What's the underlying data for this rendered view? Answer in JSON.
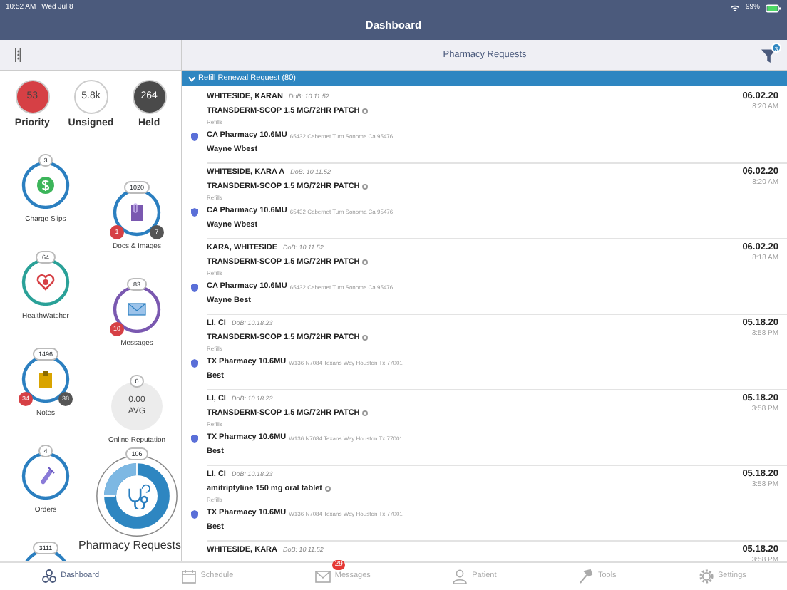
{
  "status_bar": {
    "time": "10:52 AM",
    "date": "Wed Jul 8",
    "battery": "99%"
  },
  "header": {
    "title": "Dashboard"
  },
  "counters": [
    {
      "value": "53",
      "label": "Priority",
      "color": "#d64045"
    },
    {
      "value": "5.8k",
      "label": "Unsigned",
      "color": "#ffffff"
    },
    {
      "value": "264",
      "label": "Held",
      "color": "#4a4a4a"
    }
  ],
  "widgets": {
    "column_1": [
      {
        "kind": "ring",
        "count": "3",
        "label": "Charge Slips",
        "color": "#2b7fc0"
      },
      {
        "kind": "ring",
        "count": "64",
        "label": "HealthWatcher",
        "color": "#2aa198"
      },
      {
        "kind": "ring",
        "count": "1496",
        "label": "Notes",
        "color": "#2b7fc0",
        "badges": [
          {
            "text": "34",
            "color": "#d64045"
          },
          {
            "text": "38",
            "color": "#555555"
          }
        ]
      },
      {
        "kind": "ring",
        "count": "4",
        "label": "Orders",
        "color": "#2b7fc0"
      },
      {
        "kind": "ring",
        "count": "3111",
        "color": "#2b7fc0"
      }
    ],
    "column_2": [
      {
        "kind": "ring",
        "count": "1020",
        "label": "Docs & Images",
        "color": "#2b7fc0",
        "badges": [
          {
            "text": "1",
            "color": "#d64045"
          },
          {
            "text": "7",
            "color": "#555555"
          }
        ]
      },
      {
        "kind": "ring",
        "count": "83",
        "label": "Messages",
        "color": "#7a58b0",
        "badges": [
          {
            "text": "10",
            "color": "#d64045"
          }
        ]
      },
      {
        "kind": "rating",
        "count": "0",
        "value": "0.00",
        "unit": "AVG",
        "label": "Online Reputation"
      },
      {
        "kind": "donut",
        "count": "106",
        "label": "Pharmacy Requests",
        "color": "#2e86c1"
      }
    ]
  },
  "panel": {
    "title": "Pharmacy Requests",
    "filter_badge": "3",
    "group": {
      "label": "Refill Renewal Request (80)",
      "expanded": true
    },
    "requests": [
      {
        "name": "WHITESIDE, KARAN",
        "dob": "DoB: 10.11.52",
        "drug": "TRANSDERM-SCOP 1.5 MG/72HR PATCH",
        "note": "Refills",
        "pharmacy": "CA Pharmacy 10.6MU",
        "address": "65432 Cabernet Turn  Sonoma Ca 95476",
        "prescriber": "Wayne Wbest",
        "date": "06.02.20",
        "time": "8:20 AM"
      },
      {
        "name": "WHITESIDE, KARA A",
        "dob": "DoB: 10.11.52",
        "drug": "TRANSDERM-SCOP 1.5 MG/72HR PATCH",
        "note": "Refills",
        "pharmacy": "CA Pharmacy 10.6MU",
        "address": "65432 Cabernet Turn  Sonoma Ca 95476",
        "prescriber": "Wayne Wbest",
        "date": "06.02.20",
        "time": "8:20 AM"
      },
      {
        "name": "KARA, WHITESIDE",
        "dob": "DoB: 10.11.52",
        "drug": "TRANSDERM-SCOP 1.5 MG/72HR PATCH",
        "note": "Refills",
        "pharmacy": "CA Pharmacy 10.6MU",
        "address": "65432 Cabernet Turn  Sonoma Ca 95476",
        "prescriber": "Wayne Best",
        "date": "06.02.20",
        "time": "8:18 AM"
      },
      {
        "name": "LI, CI",
        "dob": "DoB: 10.18.23",
        "drug": "TRANSDERM-SCOP 1.5 MG/72HR PATCH",
        "note": "Refills",
        "pharmacy": "TX Pharmacy 10.6MU",
        "address": "W136 N7084 Texans Way  Houston Tx 77001",
        "prescriber": "Best",
        "date": "05.18.20",
        "time": "3:58 PM"
      },
      {
        "name": "LI, CI",
        "dob": "DoB: 10.18.23",
        "drug": "TRANSDERM-SCOP 1.5 MG/72HR PATCH",
        "note": "Refills",
        "pharmacy": "TX Pharmacy 10.6MU",
        "address": "W136 N7084 Texans Way  Houston Tx 77001",
        "prescriber": "Best",
        "date": "05.18.20",
        "time": "3:58 PM"
      },
      {
        "name": "LI, CI",
        "dob": "DoB: 10.18.23",
        "drug": "amitriptyline 150 mg oral tablet",
        "note": "Refills",
        "pharmacy": "TX Pharmacy 10.6MU",
        "address": "W136 N7084 Texans Way  Houston Tx 77001",
        "prescriber": "Best",
        "date": "05.18.20",
        "time": "3:58 PM"
      },
      {
        "name": "WHITESIDE, KARA",
        "dob": "DoB: 10.11.52",
        "date": "05.18.20",
        "time": "3:58 PM"
      }
    ]
  },
  "tab_bar": [
    {
      "label": "Dashboard",
      "selected": true
    },
    {
      "label": "Schedule",
      "selected": false
    },
    {
      "label": "Messages",
      "selected": false,
      "badge": "29"
    },
    {
      "label": "Patient",
      "selected": false
    },
    {
      "label": "Tools",
      "selected": false
    },
    {
      "label": "Settings",
      "selected": false
    }
  ]
}
